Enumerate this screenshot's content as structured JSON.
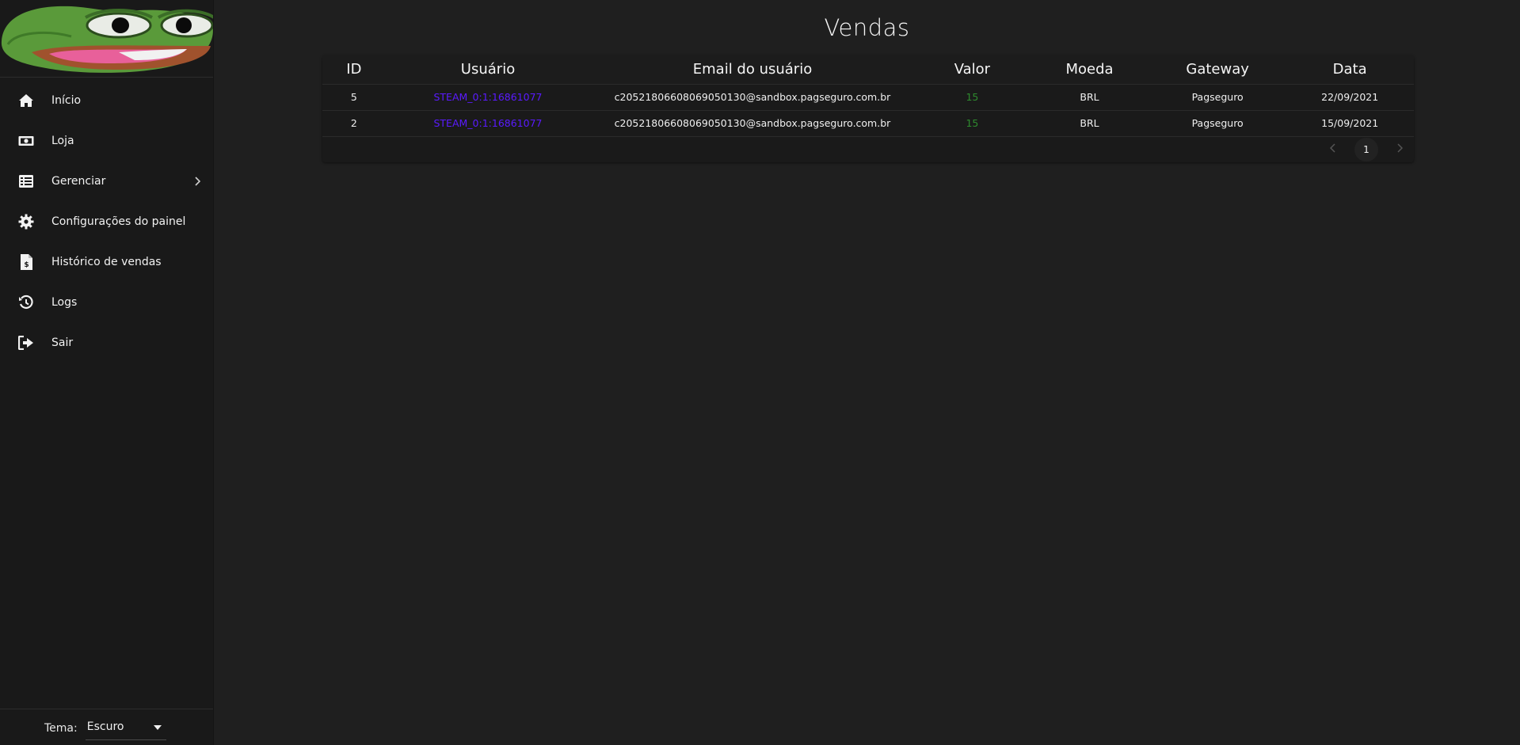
{
  "sidebar": {
    "logo_icon": "frog-face-logo",
    "items": [
      {
        "label": "Início",
        "icon": "home-icon"
      },
      {
        "label": "Loja",
        "icon": "money-icon"
      },
      {
        "label": "Gerenciar",
        "icon": "list-icon",
        "has_submenu": true
      },
      {
        "label": "Configurações do painel",
        "icon": "gear-icon"
      },
      {
        "label": "Histórico de vendas",
        "icon": "invoice-dollar-icon"
      },
      {
        "label": "Logs",
        "icon": "history-icon"
      },
      {
        "label": "Sair",
        "icon": "sign-out-icon"
      }
    ],
    "theme": {
      "label": "Tema:",
      "selected": "Escuro"
    }
  },
  "main": {
    "title": "Vendas",
    "table": {
      "columns": [
        "ID",
        "Usuário",
        "Email do usuário",
        "Valor",
        "Moeda",
        "Gateway",
        "Data"
      ],
      "rows": [
        {
          "id": "5",
          "user": "STEAM_0:1:16861077",
          "email": "c20521806608069050130@sandbox.pagseguro.com.br",
          "value": "15",
          "currency": "BRL",
          "gateway": "Pagseguro",
          "date": "22/09/2021"
        },
        {
          "id": "2",
          "user": "STEAM_0:1:16861077",
          "email": "c20521806608069050130@sandbox.pagseguro.com.br",
          "value": "15",
          "currency": "BRL",
          "gateway": "Pagseguro",
          "date": "15/09/2021"
        }
      ]
    },
    "pagination": {
      "current_page": "1",
      "prev_icon": "chevron-left-icon",
      "next_icon": "chevron-right-icon"
    }
  },
  "colors": {
    "background": "#1f1f1f",
    "sidebar": "#191919",
    "user_link": "#5a1aff",
    "value_green": "#2e8b2e"
  }
}
